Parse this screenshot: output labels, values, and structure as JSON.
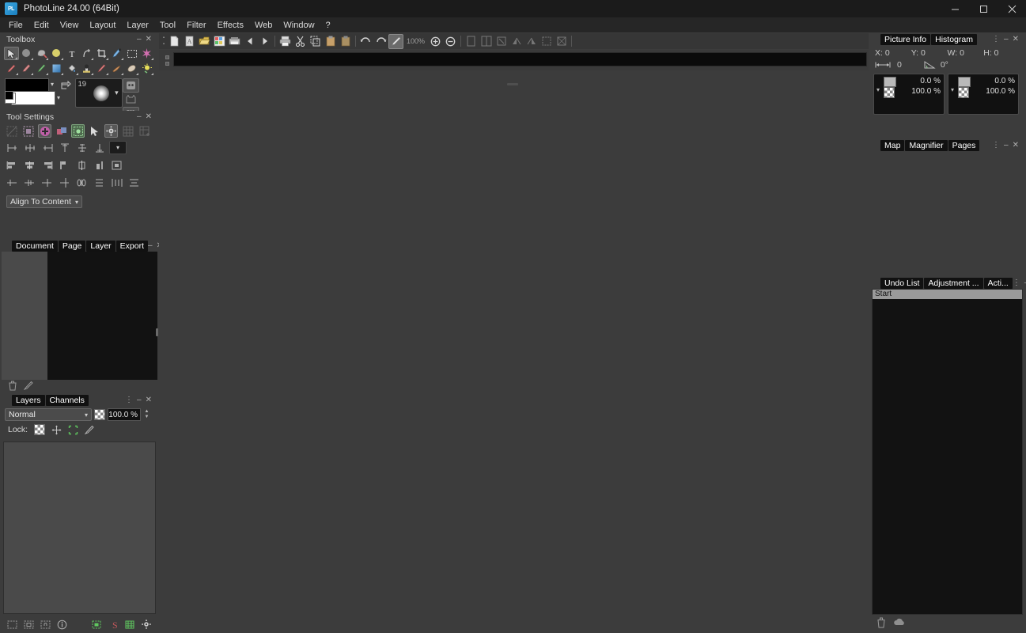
{
  "window": {
    "title": "PhotoLine 24.00 (64Bit)",
    "app_icon": "PL",
    "minimize": "–",
    "maximize": "☐",
    "close": "✕"
  },
  "menu": {
    "items": [
      "File",
      "Edit",
      "View",
      "Layout",
      "Layer",
      "Tool",
      "Filter",
      "Effects",
      "Web",
      "Window",
      "?"
    ]
  },
  "toolbox": {
    "title": "Toolbox",
    "minimize": "–",
    "close": "✕",
    "tools_row1": [
      {
        "name": "move-tool",
        "glyph": "➤",
        "selected": true
      },
      {
        "name": "ellipse-select-tool",
        "glyph": "⬤",
        "selected": false
      },
      {
        "name": "lasso-tool",
        "glyph": "❦",
        "selected": false
      },
      {
        "name": "color-picker-tool",
        "glyph": "●",
        "selected": false
      },
      {
        "name": "text-tool",
        "glyph": "T",
        "selected": false
      },
      {
        "name": "path-tool",
        "glyph": "⤴",
        "selected": false
      },
      {
        "name": "crop-tool",
        "glyph": "⌧",
        "selected": false
      },
      {
        "name": "brush-tool",
        "glyph": "✎",
        "selected": false
      },
      {
        "name": "rect-select-tool",
        "glyph": "⬚",
        "selected": false
      },
      {
        "name": "magic-wand-tool",
        "glyph": "✳",
        "selected": false
      }
    ],
    "tools_row2": [
      {
        "name": "pencil-tool",
        "glyph": "✐",
        "selected": false
      },
      {
        "name": "eraser-tool",
        "glyph": "▰",
        "selected": false
      },
      {
        "name": "clone-brush-tool",
        "glyph": "✒",
        "selected": false
      },
      {
        "name": "gradient-tool",
        "glyph": "■",
        "selected": false
      },
      {
        "name": "paint-bucket-tool",
        "glyph": "⬢",
        "selected": false
      },
      {
        "name": "stamp-tool",
        "glyph": "⚓",
        "selected": false
      },
      {
        "name": "smudge-tool",
        "glyph": "✍",
        "selected": false
      },
      {
        "name": "blur-tool",
        "glyph": "◖",
        "selected": false
      },
      {
        "name": "dodge-tool",
        "glyph": "◑",
        "selected": false
      },
      {
        "name": "sharpen-tool",
        "glyph": "☀",
        "selected": false
      }
    ],
    "foreground_color": "#000000",
    "background_color": "#ffffff",
    "swap_colors_icon": "swap-colors-icon",
    "brush_size": "19",
    "side_buttons": [
      {
        "name": "mask-mode-button",
        "glyph": "▣",
        "selected": true
      },
      {
        "name": "quick-mask-button",
        "glyph": "❦",
        "selected": false
      },
      {
        "name": "screen-mode-button",
        "glyph": "⊞",
        "selected": true
      },
      {
        "name": "preview-mode-button",
        "glyph": "❐",
        "selected": false
      }
    ]
  },
  "tool_settings": {
    "title": "Tool Settings",
    "minimize": "–",
    "close": "✕",
    "mode_buttons": [
      {
        "name": "no-selection-mode",
        "glyph": "⌧",
        "state": "dim"
      },
      {
        "name": "new-selection-mode",
        "glyph": "⊞",
        "state": "normal"
      },
      {
        "name": "add-selection-mode",
        "glyph": "✚",
        "state": "active-pink"
      },
      {
        "name": "subtract-selection-mode",
        "glyph": "❐",
        "state": "normal"
      },
      {
        "name": "intersect-selection-mode",
        "glyph": "⬚",
        "state": "active-green"
      },
      {
        "name": "arrow-pointer-mode",
        "glyph": "➤",
        "state": "plain"
      },
      {
        "name": "tool-options-button",
        "glyph": "⚙",
        "state": "active"
      },
      {
        "name": "grid-snap-button",
        "glyph": "⊞",
        "state": "dim"
      },
      {
        "name": "grid-add-button",
        "glyph": "⊞",
        "state": "dim"
      }
    ],
    "align_row1": [
      {
        "name": "align-left-icon"
      },
      {
        "name": "align-center-h-icon"
      },
      {
        "name": "align-right-icon"
      },
      {
        "name": "align-top-icon"
      },
      {
        "name": "align-middle-v-icon"
      },
      {
        "name": "align-bottom-icon"
      }
    ],
    "align_dropdown": "align-target-dropdown",
    "align_row2": [
      {
        "name": "align-edge-left-icon"
      },
      {
        "name": "align-edge-center-icon"
      },
      {
        "name": "align-edge-right-icon"
      },
      {
        "name": "align-border-left-icon"
      },
      {
        "name": "align-border-center-icon"
      },
      {
        "name": "align-border-right-icon"
      },
      {
        "name": "align-frame-icon"
      }
    ],
    "align_row3": [
      {
        "name": "distribute-left-icon"
      },
      {
        "name": "distribute-center-icon"
      },
      {
        "name": "distribute-right-icon"
      },
      {
        "name": "distribute-top-icon"
      },
      {
        "name": "distribute-space-h-icon"
      },
      {
        "name": "distribute-space-v-icon"
      },
      {
        "name": "distribute-gap-h-icon"
      },
      {
        "name": "distribute-gap-v-icon"
      }
    ],
    "align_to_label": "Align To Content"
  },
  "document_panel": {
    "tabs": [
      {
        "label": "Document",
        "active": false
      },
      {
        "label": "Page",
        "active": false
      },
      {
        "label": "Layer",
        "active": false
      },
      {
        "label": "Export",
        "active": false
      }
    ],
    "minimize": "–",
    "close": "✕",
    "footer_icons": [
      {
        "name": "delete-document-icon",
        "glyph": "🗑"
      },
      {
        "name": "new-document-icon",
        "glyph": "✐"
      }
    ]
  },
  "layers_panel": {
    "tabs": [
      {
        "label": "Layers",
        "active": false
      },
      {
        "label": "Channels",
        "active": true
      }
    ],
    "menu_dots": "⋮",
    "minimize": "–",
    "close": "✕",
    "blend_mode": "Normal",
    "opacity": "100.0 %",
    "lock_label": "Lock:",
    "lock_icons": [
      {
        "name": "lock-transparency-icon"
      },
      {
        "name": "lock-position-icon"
      },
      {
        "name": "lock-all-icon"
      },
      {
        "name": "lock-paint-icon"
      }
    ],
    "footer_icons": [
      {
        "name": "add-mask-icon",
        "glyph": "⬚"
      },
      {
        "name": "add-vector-mask-icon",
        "glyph": "⬚"
      },
      {
        "name": "lock-layer-icon",
        "glyph": "⚿"
      },
      {
        "name": "layer-info-icon",
        "glyph": "ⓘ"
      },
      {
        "name": "new-layer-icon",
        "glyph": "⊞"
      },
      {
        "name": "layer-style-icon",
        "glyph": "S"
      },
      {
        "name": "new-group-icon",
        "glyph": "⊞"
      },
      {
        "name": "layer-settings-icon",
        "glyph": "⚙"
      }
    ]
  },
  "document_toolbar": {
    "zoom_level": "100%",
    "icons": [
      {
        "name": "new-document-icon",
        "glyph": "□",
        "state": "normal"
      },
      {
        "name": "new-from-template-icon",
        "glyph": "▤",
        "state": "normal"
      },
      {
        "name": "open-document-icon",
        "glyph": "📂",
        "state": "normal"
      },
      {
        "name": "browse-images-icon",
        "glyph": "▦",
        "state": "normal"
      },
      {
        "name": "save-document-icon",
        "glyph": "▬",
        "state": "normal"
      },
      {
        "name": "previous-image-icon",
        "glyph": "◀",
        "state": "normal"
      },
      {
        "name": "next-image-icon",
        "glyph": "▶",
        "state": "normal"
      },
      {
        "name": "print-icon",
        "glyph": "⎙",
        "state": "normal"
      },
      {
        "name": "cut-icon",
        "glyph": "✂",
        "state": "normal"
      },
      {
        "name": "copy-icon",
        "glyph": "⧉",
        "state": "normal"
      },
      {
        "name": "paste-icon",
        "glyph": "⬚",
        "state": "normal"
      },
      {
        "name": "paste-special-icon",
        "glyph": "⬚",
        "state": "normal"
      },
      {
        "name": "undo-icon",
        "glyph": "↶",
        "state": "normal"
      },
      {
        "name": "redo-icon",
        "glyph": "↷",
        "state": "normal"
      },
      {
        "name": "color-picker-icon",
        "glyph": "╱",
        "state": "active"
      },
      {
        "name": "zoom-in-icon",
        "glyph": "⊕",
        "state": "normal"
      },
      {
        "name": "zoom-out-icon",
        "glyph": "⊖",
        "state": "normal"
      },
      {
        "name": "page-view-icon",
        "glyph": "▧",
        "state": "dim"
      },
      {
        "name": "spread-view-icon",
        "glyph": "▨",
        "state": "dim"
      },
      {
        "name": "rotate-icon",
        "glyph": "⟳",
        "state": "dim"
      },
      {
        "name": "flip-horizontal-icon",
        "glyph": "◢",
        "state": "dim"
      },
      {
        "name": "flip-vertical-icon",
        "glyph": "◣",
        "state": "dim"
      },
      {
        "name": "crop-icon",
        "glyph": "⌧",
        "state": "dim"
      },
      {
        "name": "transform-icon",
        "glyph": "⬚",
        "state": "dim"
      }
    ]
  },
  "picture_info": {
    "tabs": [
      {
        "label": "Picture Info",
        "active": false
      },
      {
        "label": "Histogram",
        "active": true
      }
    ],
    "menu_dots": "⋮",
    "minimize": "–",
    "close": "✕",
    "x_label": "X:",
    "x_value": "0",
    "y_label": "Y:",
    "y_value": "0",
    "w_label": "W:",
    "w_value": "0",
    "h_label": "H:",
    "h_value": "0",
    "distance_value": "0",
    "angle_value": "0°",
    "color_panels": [
      {
        "name": "foreground-color-readout",
        "top_value": "0.0 %",
        "bottom_value": "100.0 %",
        "swatch": "#b9b9b9"
      },
      {
        "name": "background-color-readout",
        "top_value": "0.0 %",
        "bottom_value": "100.0 %",
        "swatch": "#b9b9b9"
      }
    ]
  },
  "map_panel": {
    "tabs": [
      {
        "label": "Map",
        "active": false
      },
      {
        "label": "Magnifier",
        "active": true
      },
      {
        "label": "Pages",
        "active": true
      }
    ],
    "menu_dots": "⋮",
    "minimize": "–",
    "close": "✕"
  },
  "undo_panel": {
    "tabs": [
      {
        "label": "Undo List",
        "active": false
      },
      {
        "label": "Adjustment ...",
        "active": true
      },
      {
        "label": "Acti...",
        "active": true
      }
    ],
    "menu_dots": "⋮",
    "minimize": "–",
    "close": "✕",
    "entries": [
      "Start"
    ],
    "footer_icons": [
      {
        "name": "delete-undo-step-icon",
        "glyph": "🗑"
      },
      {
        "name": "snapshot-icon",
        "glyph": "☁"
      }
    ]
  }
}
